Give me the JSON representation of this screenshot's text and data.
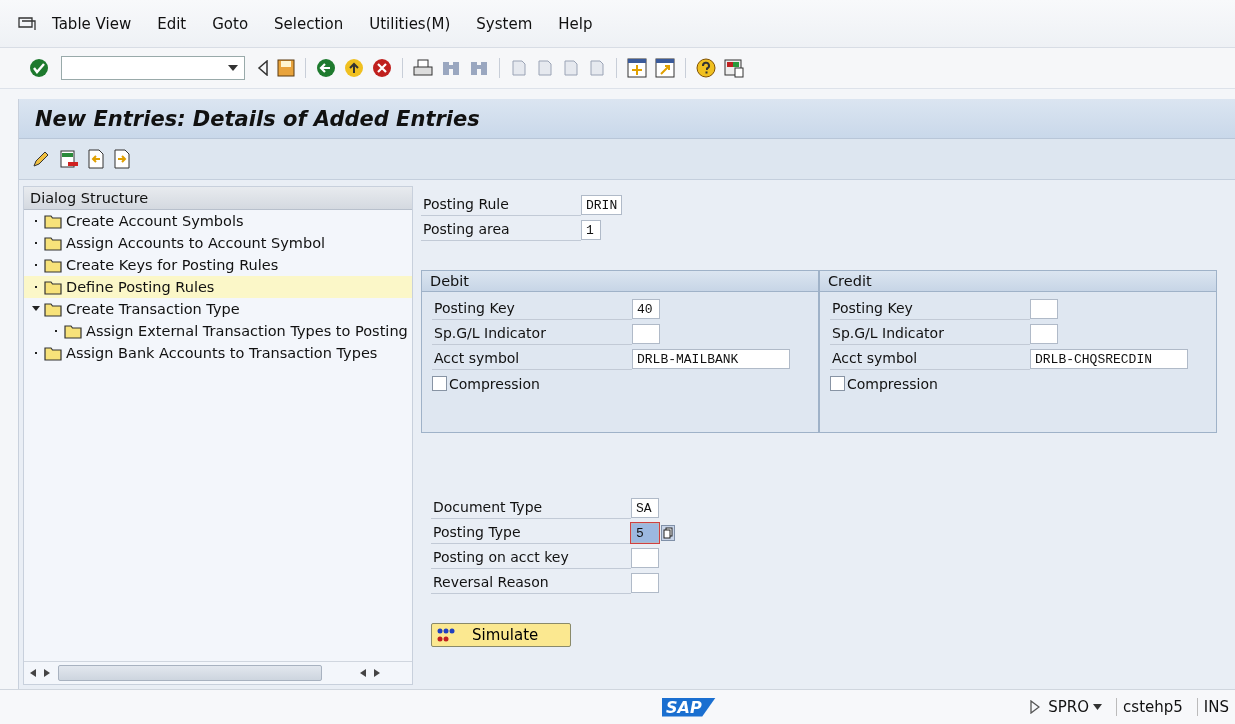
{
  "menu": [
    "Table View",
    "Edit",
    "Goto",
    "Selection",
    "Utilities(M)",
    "System",
    "Help"
  ],
  "title": "New Entries: Details of Added Entries",
  "dialog_structure": {
    "title": "Dialog Structure",
    "items": [
      {
        "label": "Create Account Symbols",
        "selected": false,
        "expanded": false
      },
      {
        "label": "Assign Accounts to Account Symbol",
        "selected": false,
        "expanded": false
      },
      {
        "label": "Create Keys for Posting Rules",
        "selected": false,
        "expanded": false
      },
      {
        "label": "Define Posting Rules",
        "selected": true,
        "expanded": false
      },
      {
        "label": "Create Transaction Type",
        "selected": false,
        "expanded": true,
        "children": [
          {
            "label": "Assign External Transaction Types to Posting",
            "selected": false,
            "expanded": false
          }
        ]
      },
      {
        "label": "Assign Bank Accounts to Transaction Types",
        "selected": false,
        "expanded": false
      }
    ]
  },
  "header_fields": [
    {
      "label": "Posting Rule",
      "value": "DRIN"
    },
    {
      "label": "Posting area",
      "value": "1"
    }
  ],
  "groups": [
    {
      "title": "Debit",
      "fields": [
        {
          "kind": "code",
          "label": "Posting Key",
          "value": "40"
        },
        {
          "kind": "code",
          "label": "Sp.G/L Indicator"
        },
        {
          "kind": "symbol",
          "label": "Acct symbol",
          "value": "DRLB-MAILBANK"
        },
        {
          "kind": "checkbox",
          "label": "Compression",
          "checked": false
        }
      ]
    },
    {
      "title": "Credit",
      "fields": [
        {
          "kind": "code",
          "label": "Posting Key"
        },
        {
          "kind": "code",
          "label": "Sp.G/L Indicator"
        },
        {
          "kind": "symbol",
          "label": "Acct symbol",
          "value": "DRLB-CHQSRECDIN"
        },
        {
          "kind": "checkbox",
          "label": "Compression",
          "checked": false
        }
      ]
    }
  ],
  "document_fields": [
    {
      "label": "Document Type",
      "value": "SA",
      "selected": false
    },
    {
      "label": "Posting Type",
      "value": "5",
      "selected": true
    },
    {
      "label": "Posting on acct key",
      "selected": false
    },
    {
      "label": "Reversal Reason",
      "selected": false
    }
  ],
  "simulate_button": "Simulate",
  "status_bar": {
    "logo": "SAP",
    "transaction": "SPRO",
    "system": "cstehp5",
    "mode": "INS"
  }
}
